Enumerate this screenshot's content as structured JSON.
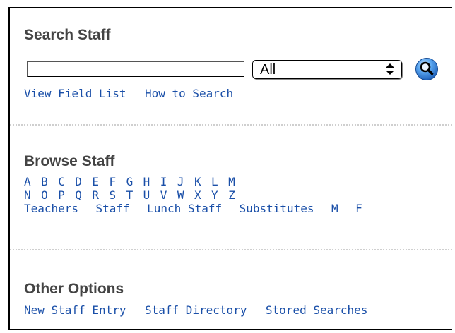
{
  "search": {
    "heading": "Search Staff",
    "input_value": "",
    "select": {
      "selected": "All"
    },
    "links": [
      {
        "label": "View Field List"
      },
      {
        "label": "How to Search"
      }
    ]
  },
  "browse": {
    "heading": "Browse Staff",
    "letters_row1": [
      "A",
      "B",
      "C",
      "D",
      "E",
      "F",
      "G",
      "H",
      "I",
      "J",
      "K",
      "L",
      "M"
    ],
    "letters_row2": [
      "N",
      "O",
      "P",
      "Q",
      "R",
      "S",
      "T",
      "U",
      "V",
      "W",
      "X",
      "Y",
      "Z"
    ],
    "categories": [
      "Teachers",
      "Staff",
      "Lunch Staff",
      "Substitutes",
      "M",
      "F"
    ]
  },
  "other": {
    "heading": "Other Options",
    "links": [
      {
        "label": "New Staff Entry"
      },
      {
        "label": "Staff Directory"
      },
      {
        "label": "Stored Searches"
      }
    ]
  },
  "colors": {
    "link": "#1a4fa8",
    "heading": "#444444",
    "go_button": "#2f7fd8"
  },
  "icons": {
    "go_button": "magnifier-icon",
    "select_arrows": "up-down-arrows-icon"
  }
}
